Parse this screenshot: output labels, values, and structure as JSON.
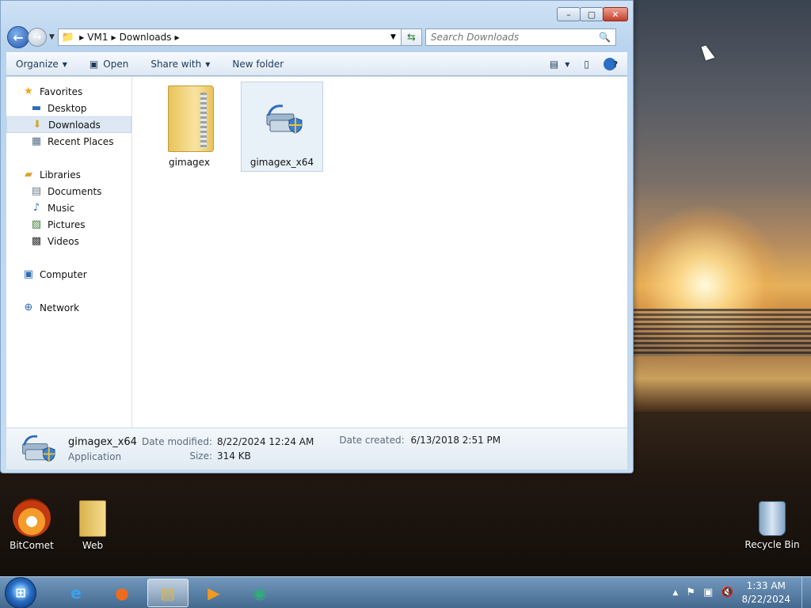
{
  "window": {
    "caption_buttons": [
      "–",
      "▢",
      "✕"
    ]
  },
  "nav": {
    "breadcrumbs": [
      "VM1",
      "Downloads"
    ],
    "search_placeholder": "Search Downloads"
  },
  "commands": {
    "organize": "Organize",
    "open": "Open",
    "share_with": "Share with",
    "new_folder": "New folder"
  },
  "navpane": {
    "favorites": "Favorites",
    "favorites_items": [
      "Desktop",
      "Downloads",
      "Recent Places"
    ],
    "libraries": "Libraries",
    "libraries_items": [
      "Documents",
      "Music",
      "Pictures",
      "Videos"
    ],
    "computer": "Computer",
    "network": "Network"
  },
  "files": [
    {
      "name": "gimagex"
    },
    {
      "name": "gimagex_x64"
    }
  ],
  "details": {
    "name": "gimagex_x64",
    "type": "Application",
    "modified_label": "Date modified:",
    "modified_value": "8/22/2024 12:24 AM",
    "size_label": "Size:",
    "size_value": "314 KB",
    "created_label": "Date created:",
    "created_value": "6/13/2018 2:51 PM"
  },
  "desktop": {
    "icons": [
      "BitComet",
      "Web",
      "Recycle Bin"
    ]
  },
  "taskbar": {
    "time": "1:33 AM",
    "date": "8/22/2024"
  },
  "colors": {
    "accent": "#2b6fc4",
    "selection": "#dde8f4"
  }
}
